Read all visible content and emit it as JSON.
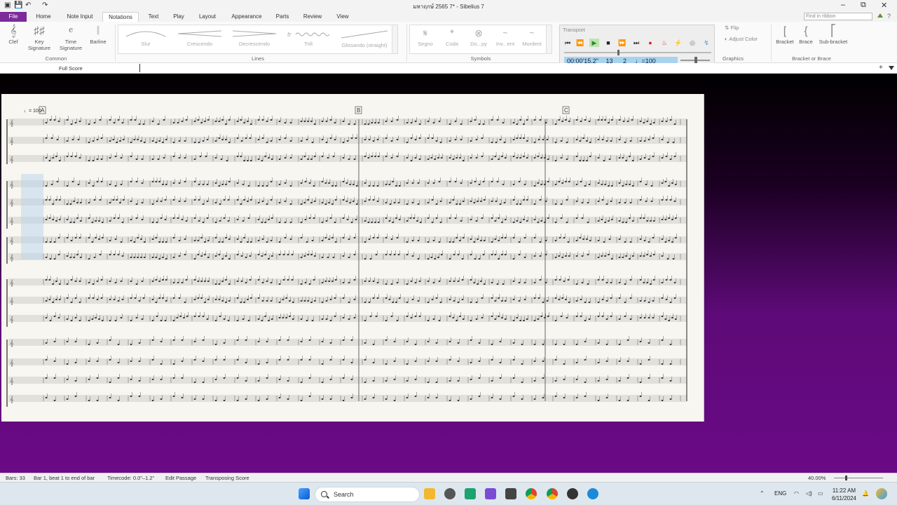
{
  "window": {
    "title": "มหาฤกษ์ 2565 7* - Sibelius 7",
    "quick_access": [
      "💾",
      "📄",
      "↶",
      "↷"
    ],
    "controls": [
      "–",
      "⧉",
      "✕"
    ]
  },
  "tabs": [
    "File",
    "Home",
    "Note Input",
    "Notations",
    "Text",
    "Play",
    "Layout",
    "Appearance",
    "Parts",
    "Review",
    "View"
  ],
  "find_placeholder": "Find in ribbon",
  "ribbon": {
    "common": {
      "label": "Common",
      "buttons": [
        "Clef",
        "Key Signature",
        "Time Signature",
        "Barline"
      ]
    },
    "lines": {
      "label": "Lines",
      "items": [
        "Slur",
        "Crescendo",
        "Decrescendo",
        "Trill",
        "Glissando (straight)"
      ]
    },
    "symbols": {
      "label": "Symbols",
      "items": [
        "Segno",
        "Coda",
        "Do...py",
        "Inv...ent",
        "Mordent"
      ]
    },
    "graphics": {
      "label": "Graphics",
      "flip": "Flip",
      "adjust_color": "Adjust Color"
    },
    "bracket": {
      "label": "Bracket or Brace",
      "buttons": [
        "Bracket",
        "Brace",
        "Sub-bracket"
      ]
    }
  },
  "transport": {
    "label": "Transport",
    "timecode": "00:00'15.2\"",
    "bar": "13",
    "beat": "2",
    "tempo": "♩=100"
  },
  "subheader": {
    "score_name": "Full Score"
  },
  "score": {
    "rehearsal_marks": [
      "A",
      "B",
      "C"
    ],
    "tempo_marking": "♩= 100"
  },
  "status": {
    "items": [
      "Bars: 33",
      "Bar 1, beat 1 to end of bar",
      "Timecode: 0.0\"–1.2\"",
      "Edit Passage",
      "Transposing Score"
    ],
    "zoom": "40.00%"
  },
  "taskbar": {
    "search_label": "Search",
    "lang": "ENG",
    "time": "11:22 AM",
    "date": "6/11/2024"
  },
  "colors": {
    "file_tab": "#7b2b9a",
    "timecode_bg": "#a9d2ef",
    "workspace": "#6a0a86"
  }
}
